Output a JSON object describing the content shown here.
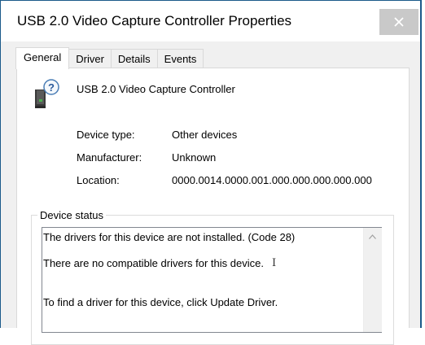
{
  "window": {
    "title": "USB 2.0 Video Capture Controller Properties",
    "close_icon": "close-x"
  },
  "tabs": [
    {
      "label": "General",
      "active": true
    },
    {
      "label": "Driver",
      "active": false
    },
    {
      "label": "Details",
      "active": false
    },
    {
      "label": "Events",
      "active": false
    }
  ],
  "device": {
    "icon": "unknown-device-question-icon",
    "name": "USB 2.0 Video Capture Controller"
  },
  "properties": [
    {
      "label": "Device type:",
      "value": "Other devices"
    },
    {
      "label": "Manufacturer:",
      "value": "Unknown"
    },
    {
      "label": "Location:",
      "value": "0000.0014.0000.001.000.000.000.000.000"
    }
  ],
  "device_status": {
    "legend": "Device status",
    "lines": [
      "The drivers for this device are not installed. (Code 28)",
      "There are no compatible drivers for this device.",
      "To find a driver for this device, click Update Driver."
    ]
  },
  "colors": {
    "accent_border": "#1b5a8a",
    "close_button_bg": "#c9c9c9",
    "dialog_bg": "#f0f0f0"
  }
}
